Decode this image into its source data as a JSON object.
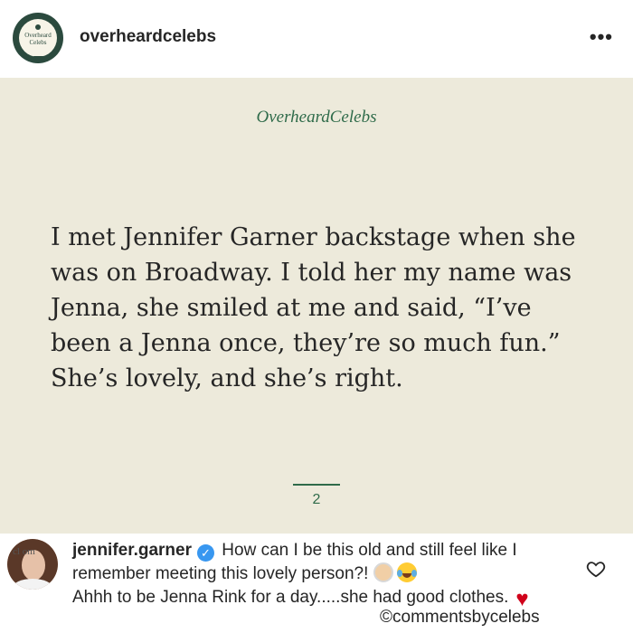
{
  "header": {
    "logo_text": "Overheard Celebs",
    "username": "overheardcelebs",
    "more_label": "•••"
  },
  "post": {
    "brand": "OverheardCelebs",
    "quote": "I met Jennifer Garner backstage when she was on Broadway. I told her my name was Jenna, she smiled at me and said, “I’ve been a Jenna once, they’re so much fun.” She’s lovely, and she’s right.",
    "page_number": "2",
    "background_color": "#edeadb",
    "accent_color": "#2f6b4a"
  },
  "comment": {
    "username": "jennifer.garner",
    "verified": true,
    "text_part1": "How can I be this old and still feel like I remember meeting this lovely person?!",
    "emojis": [
      "older-woman-emoji",
      "tears-of-joy-emoji"
    ],
    "text_part2": "Ahhh to be Jenna Rink for a day.....she had good clothes.",
    "heart_emoji": "♥",
    "avatar_watermark": "cl     om",
    "watermark": "©commentsbycelebs"
  },
  "icons": {
    "like": "heart-outline-icon",
    "verified": "verified-badge-icon",
    "more": "more-options-icon"
  }
}
